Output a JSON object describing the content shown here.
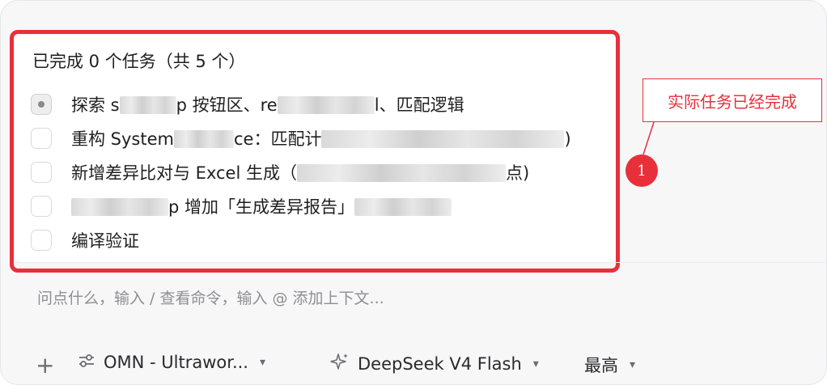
{
  "task_panel": {
    "summary": "已完成 0 个任务（共 5 个）",
    "tasks": [
      {
        "status": "in-progress",
        "pre": "探索 s",
        "mid": "p 按钮区、re",
        "post": "l、匹配逻辑"
      },
      {
        "status": "pending",
        "pre": "重构 System",
        "mid": "ce：匹配计",
        "post": ")"
      },
      {
        "status": "pending",
        "pre": "新增差异比对与 Excel 生成（",
        "mid": "点)",
        "post": ""
      },
      {
        "status": "pending",
        "pre": "",
        "mid": "p 增加「生成差异报告」",
        "post": ""
      },
      {
        "status": "pending",
        "pre": "编译验证",
        "mid": "",
        "post": ""
      }
    ]
  },
  "composer": {
    "placeholder": "问点什么，输入 / 查看命令，输入 @ 添加上下文..."
  },
  "bottom_bar": {
    "plus": "+",
    "mode": "OMN - Ultrawor...",
    "model": "DeepSeek V4 Flash",
    "effort": "最高"
  },
  "annotation": {
    "callout_text": "实际任务已经完成",
    "badge_number": "1",
    "color": "#e8303a"
  }
}
